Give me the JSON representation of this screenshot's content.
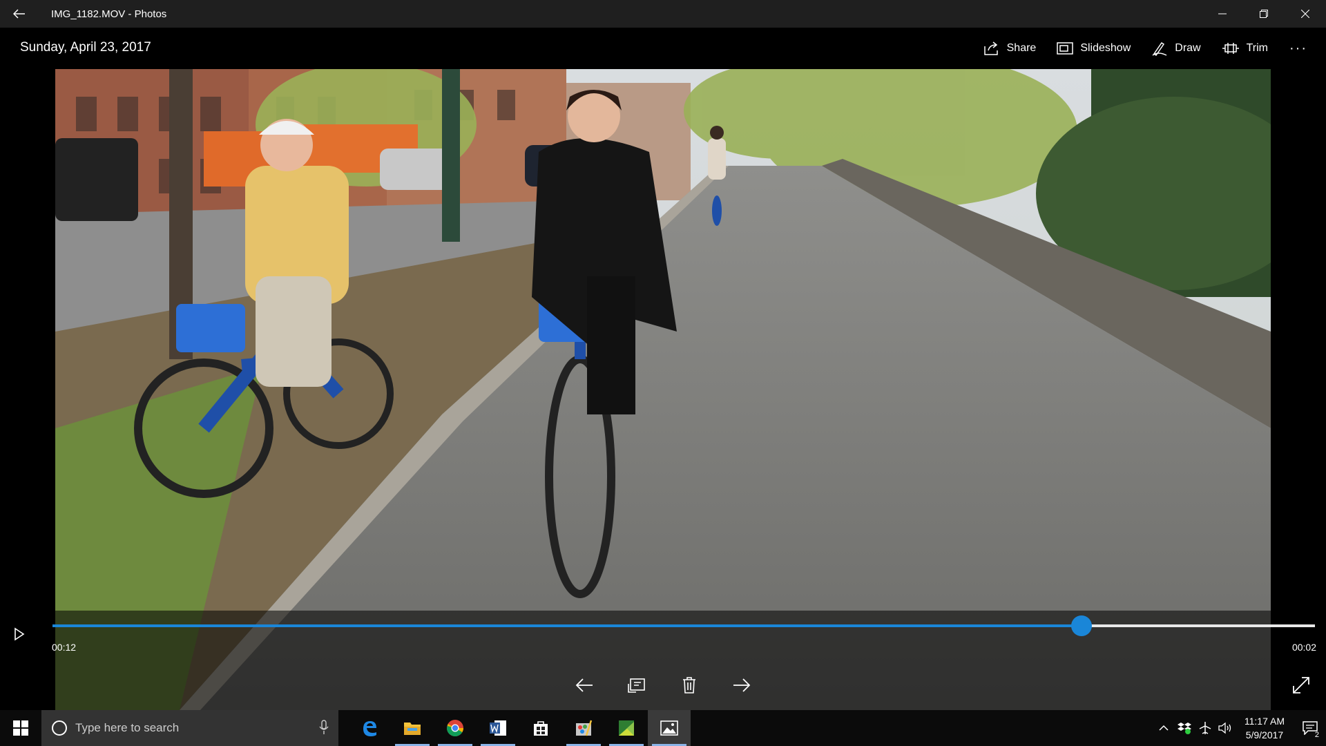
{
  "window": {
    "title": "IMG_1182.MOV - Photos"
  },
  "commandbar": {
    "date": "Sunday, April 23, 2017",
    "actions": [
      {
        "label": "Share",
        "icon": "share-icon"
      },
      {
        "label": "Slideshow",
        "icon": "slideshow-icon"
      },
      {
        "label": "Draw",
        "icon": "draw-icon"
      },
      {
        "label": "Trim",
        "icon": "trim-icon"
      }
    ],
    "more_icon": "more-icon"
  },
  "player": {
    "elapsed": "00:12",
    "remaining": "00:02",
    "progress": 0.815,
    "accent": "#1a86d8"
  },
  "taskbar": {
    "search_placeholder": "Type here to search",
    "apps": [
      "edge",
      "file-explorer",
      "chrome",
      "word",
      "store",
      "paint",
      "image-viewer",
      "photos"
    ],
    "time": "11:17 AM",
    "date": "5/9/2017",
    "notifications": "2"
  }
}
